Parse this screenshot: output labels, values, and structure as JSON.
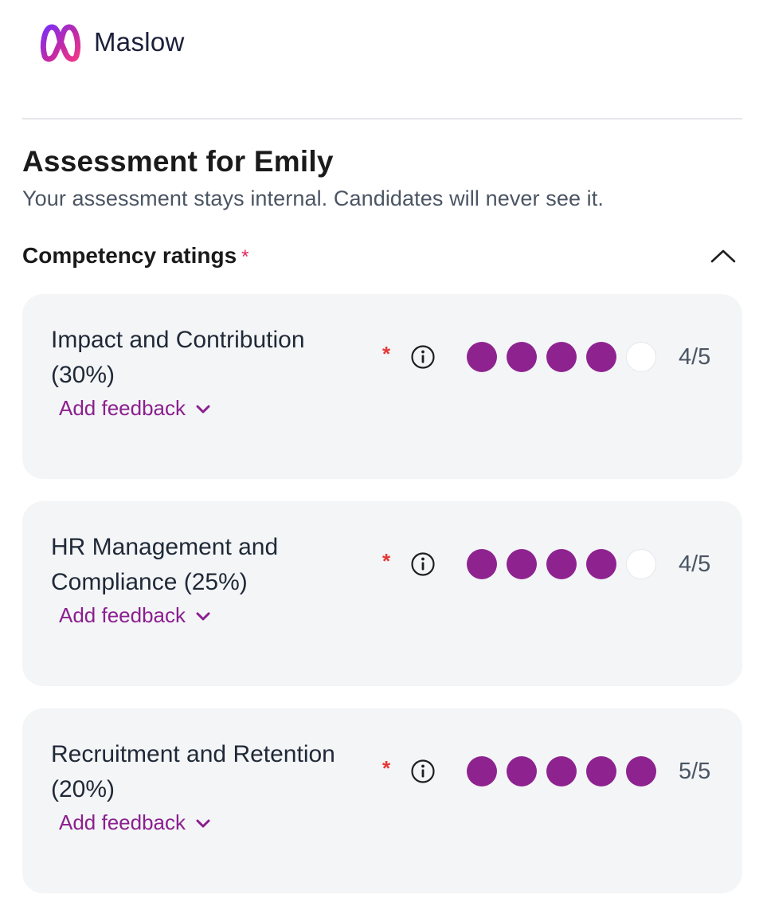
{
  "brand": {
    "name": "Maslow",
    "logo_icon": "maslow-m-logo",
    "gradient_start": "#7b2ff7",
    "gradient_end": "#e0308f"
  },
  "assessment": {
    "title": "Assessment for Emily",
    "subtitle": "Your assessment stays internal. Candidates will never see it."
  },
  "section": {
    "title": "Competency ratings",
    "required_mark": "*",
    "collapse_icon": "chevron-up-icon"
  },
  "competencies": [
    {
      "name_line1": "Impact and Contribution",
      "name_line2": "(30%)",
      "required_mark": "*",
      "info_icon": "info-icon",
      "rating": 4,
      "max": 5,
      "score_label": "4/5",
      "feedback_label": "Add feedback"
    },
    {
      "name_line1": "HR Management and",
      "name_line2": "Compliance (25%)",
      "required_mark": "*",
      "info_icon": "info-icon",
      "rating": 4,
      "max": 5,
      "score_label": "4/5",
      "feedback_label": "Add feedback"
    },
    {
      "name_line1": "Recruitment and Retention",
      "name_line2": "(20%)",
      "required_mark": "*",
      "info_icon": "info-icon",
      "rating": 5,
      "max": 5,
      "score_label": "5/5",
      "feedback_label": "Add feedback"
    }
  ],
  "colors": {
    "rating_filled": "#8e2390",
    "rating_empty": "#ffffff",
    "accent_text": "#8b1f8f",
    "required": "#e53935",
    "card_bg": "#f4f5f7"
  }
}
